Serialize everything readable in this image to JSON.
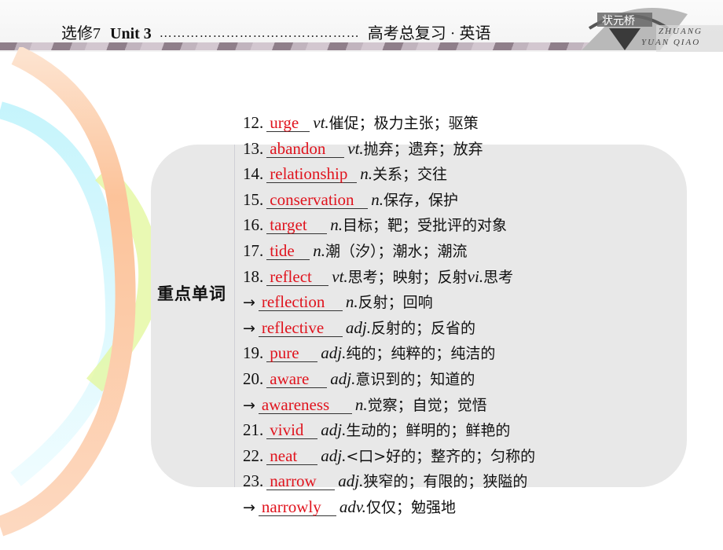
{
  "header": {
    "course": "选修7",
    "unit": "Unit  3",
    "dots": "………………………………………",
    "book": "高考总复习 · 英语",
    "logo_line1": "ZHUANG",
    "logo_line2": "YUAN QIAO"
  },
  "panel": {
    "label": "重点单词"
  },
  "colors": {
    "answer": "#e0141e",
    "panel_bg": "#e8e8e8"
  },
  "vocab": [
    {
      "prefix": "12.",
      "answer": "urge",
      "pos": "vt.",
      "def": " 催促；极力主张；驱策",
      "width": 48
    },
    {
      "prefix": "13.",
      "answer": "abandon",
      "pos": "vt.",
      "def": "抛弃；遗弃；放弃",
      "width": 92
    },
    {
      "prefix": "14.",
      "answer": "relationship",
      "pos": "n.",
      "def": "关系；交往",
      "width": 108
    },
    {
      "prefix": "15.",
      "answer": "conservation",
      "pos": "n.",
      "def": "保存，保护",
      "width": 122
    },
    {
      "prefix": "16.",
      "answer": "target",
      "pos": "n.",
      "def": "目标；靶；受批评的对象",
      "width": 70
    },
    {
      "prefix": "17.",
      "answer": "tide",
      "pos": "n.",
      "def": "潮（汐）；潮水；潮流",
      "width": 48
    },
    {
      "prefix": "18.",
      "answer": "reflect",
      "pos": "vt.",
      "def": "思考；映射；反射",
      "pos2": "vi.",
      "def2": "思考",
      "width": 72
    },
    {
      "prefix": "→",
      "answer": "reflection",
      "pos": "n.",
      "def": "反射；回响",
      "width": 100
    },
    {
      "prefix": "→",
      "answer": "reflective",
      "pos": "adj.",
      "def": "反射的；反省的",
      "width": 100
    },
    {
      "prefix": "19.",
      "answer": "pure",
      "pos": "adj.",
      "def": " 纯的；纯粹的；纯洁的",
      "width": 58
    },
    {
      "prefix": "20.",
      "answer": "aware",
      "pos": "adj.",
      "def": "意识到的；知道的",
      "width": 70
    },
    {
      "prefix": "→",
      "answer": "awareness",
      "pos": "n.",
      "def": "觉察；自觉；觉悟",
      "width": 112
    },
    {
      "prefix": "21.",
      "answer": "vivid",
      "pos": "adj.",
      "def": "生动的；鲜明的；鲜艳的",
      "width": 58
    },
    {
      "prefix": "22.",
      "answer": "neat",
      "pos": "adj.",
      "def": "<口>好的；整齐的；匀称的",
      "width": 58
    },
    {
      "prefix": "23.",
      "answer": "narrow",
      "pos": "adj.",
      "def": "狭窄的；有限的；狭隘的",
      "width": 80
    },
    {
      "prefix": "→",
      "answer": "narrowly",
      "pos": "adv.",
      "def": "仅仅；勉强地",
      "width": 92
    }
  ]
}
